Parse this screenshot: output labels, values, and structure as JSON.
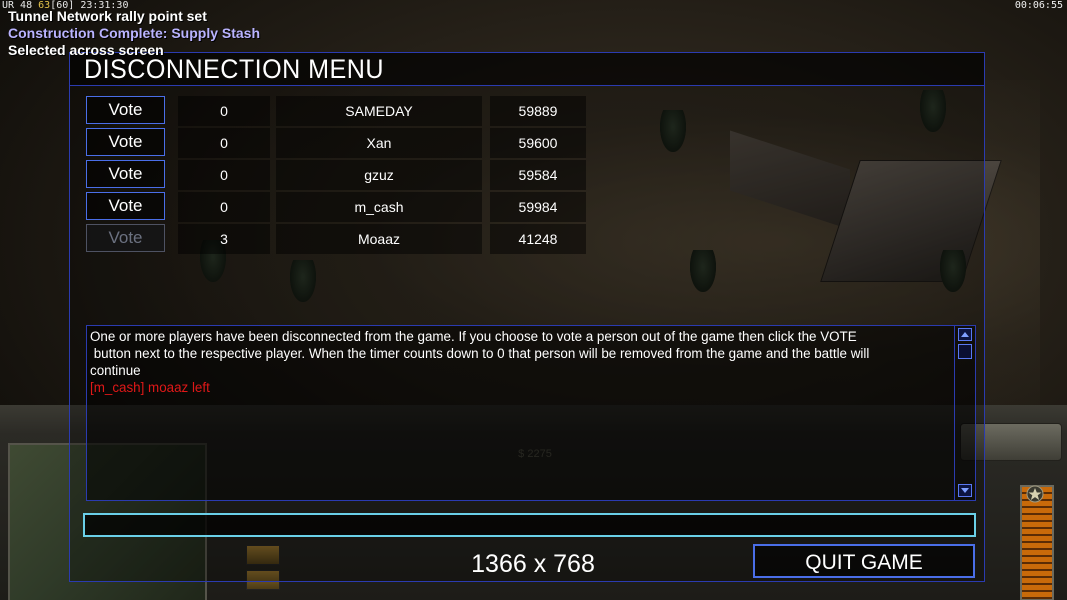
{
  "system_bar": {
    "prefix": "UR 48",
    "fps": "63",
    "fps_limit": "[60]",
    "time": "23:31:30"
  },
  "clock": "00:06:55",
  "messages": [
    {
      "text": "Tunnel Network rally point set",
      "color": "#ffffff"
    },
    {
      "text": "Construction Complete: Supply Stash",
      "color": "#b9b3ff"
    },
    {
      "text": "Selected across screen",
      "color": "#ffffff"
    }
  ],
  "dialog": {
    "title": "DISCONNECTION MENU",
    "vote_label": "Vote",
    "players": [
      {
        "votes": "0",
        "name": "SAMEDAY",
        "ping": "59889",
        "vote_enabled": true
      },
      {
        "votes": "0",
        "name": "Xan",
        "ping": "59600",
        "vote_enabled": true
      },
      {
        "votes": "0",
        "name": "gzuz",
        "ping": "59584",
        "vote_enabled": true
      },
      {
        "votes": "0",
        "name": "m_cash",
        "ping": "59984",
        "vote_enabled": true
      },
      {
        "votes": "3",
        "name": "Moaaz",
        "ping": "41248",
        "vote_enabled": false
      }
    ],
    "info_lines": [
      "One or more players have been disconnected from the game. If you choose to vote a person out of the game then click the VOTE",
      " button next to the respective player. When the timer counts down to 0 that person will be removed from the game and the battle will",
      "continue"
    ],
    "log_line": "[m_cash] moaaz left",
    "chat_value": "",
    "quit_label": "QUIT GAME"
  },
  "resolution": "1366 x 768",
  "hud": {
    "money": "$ 2275"
  },
  "colors": {
    "accent_blue": "#2b3bb0",
    "button_border": "#4a6ee8",
    "chat_border": "#6ad0e8",
    "log_red": "#e01818"
  }
}
